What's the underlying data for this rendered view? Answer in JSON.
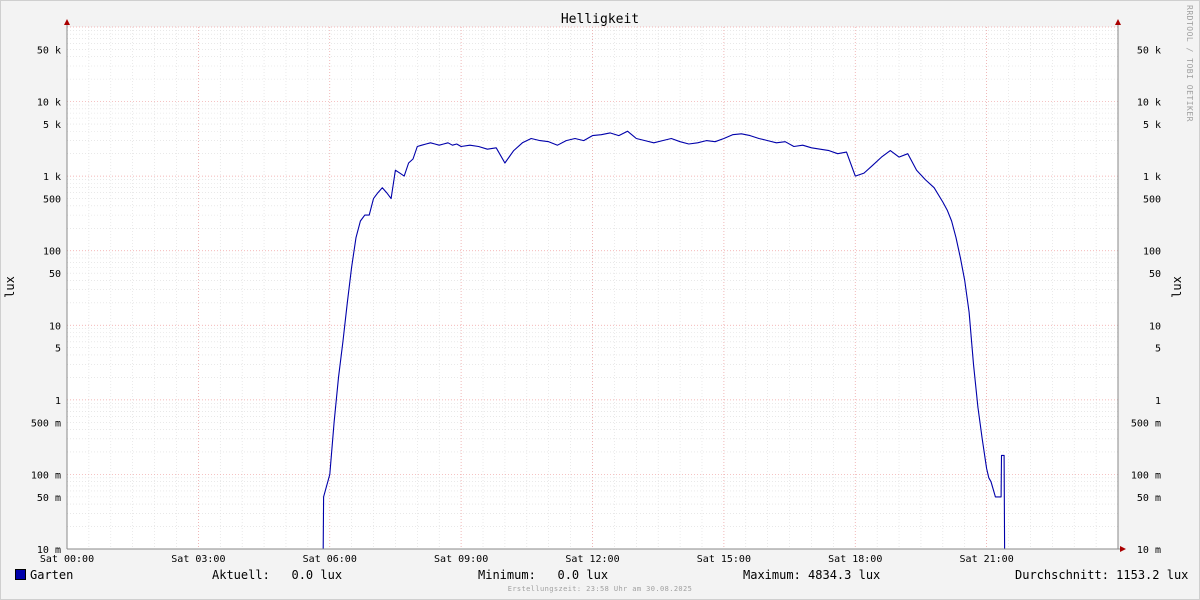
{
  "chart_data": {
    "type": "line",
    "title": "Helligkeit",
    "ylabel": "lux",
    "y_scale": "log",
    "ylim": [
      0.01,
      100000
    ],
    "y_ticks": [
      {
        "v": 50000,
        "label": "50 k"
      },
      {
        "v": 10000,
        "label": "10 k"
      },
      {
        "v": 5000,
        "label": "5 k"
      },
      {
        "v": 1000,
        "label": "1 k"
      },
      {
        "v": 500,
        "label": "500"
      },
      {
        "v": 100,
        "label": "100"
      },
      {
        "v": 50,
        "label": "50"
      },
      {
        "v": 10,
        "label": "10"
      },
      {
        "v": 5,
        "label": "5"
      },
      {
        "v": 1,
        "label": "1"
      },
      {
        "v": 0.5,
        "label": "500 m"
      },
      {
        "v": 0.1,
        "label": "100 m"
      },
      {
        "v": 0.05,
        "label": "50 m"
      },
      {
        "v": 0.01,
        "label": "10 m"
      }
    ],
    "x_unit": "hours",
    "xlim": [
      0,
      24
    ],
    "x_ticks": [
      {
        "v": 0,
        "label": "Sat 00:00"
      },
      {
        "v": 3,
        "label": "Sat 03:00"
      },
      {
        "v": 6,
        "label": "Sat 06:00"
      },
      {
        "v": 9,
        "label": "Sat 09:00"
      },
      {
        "v": 12,
        "label": "Sat 12:00"
      },
      {
        "v": 15,
        "label": "Sat 15:00"
      },
      {
        "v": 18,
        "label": "Sat 18:00"
      },
      {
        "v": 21,
        "label": "Sat 21:00"
      }
    ],
    "grid": true,
    "series": [
      {
        "name": "Garten",
        "color": "#0000aa",
        "x": [
          0,
          5.85,
          5.86,
          6.0,
          6.1,
          6.2,
          6.3,
          6.4,
          6.5,
          6.6,
          6.7,
          6.8,
          6.9,
          7.0,
          7.1,
          7.2,
          7.3,
          7.4,
          7.5,
          7.6,
          7.7,
          7.8,
          7.9,
          8.0,
          8.1,
          8.2,
          8.3,
          8.4,
          8.5,
          8.6,
          8.7,
          8.8,
          8.9,
          9.0,
          9.2,
          9.4,
          9.6,
          9.8,
          10.0,
          10.2,
          10.4,
          10.6,
          10.8,
          11.0,
          11.2,
          11.4,
          11.6,
          11.8,
          12.0,
          12.2,
          12.4,
          12.6,
          12.8,
          13.0,
          13.2,
          13.4,
          13.6,
          13.8,
          14.0,
          14.2,
          14.4,
          14.6,
          14.8,
          15.0,
          15.2,
          15.4,
          15.6,
          15.8,
          16.0,
          16.2,
          16.4,
          16.6,
          16.8,
          17.0,
          17.2,
          17.4,
          17.6,
          17.8,
          18.0,
          18.2,
          18.4,
          18.6,
          18.8,
          19.0,
          19.2,
          19.4,
          19.6,
          19.8,
          20.0,
          20.1,
          20.2,
          20.3,
          20.4,
          20.5,
          20.6,
          20.7,
          20.8,
          20.9,
          21.0,
          21.05,
          21.1,
          21.2,
          21.25,
          21.3,
          21.33,
          21.34,
          21.4,
          21.41,
          24
        ],
        "y": [
          0.01,
          0.01,
          0.05,
          0.1,
          0.5,
          2,
          6,
          20,
          60,
          150,
          250,
          300,
          300,
          500,
          600,
          700,
          600,
          500,
          1200,
          1100,
          1000,
          1500,
          1700,
          2500,
          2600,
          2700,
          2800,
          2700,
          2600,
          2700,
          2800,
          2600,
          2700,
          2500,
          2600,
          2500,
          2300,
          2400,
          1500,
          2200,
          2800,
          3200,
          3000,
          2900,
          2600,
          3000,
          3200,
          3000,
          3500,
          3600,
          3800,
          3500,
          4000,
          3200,
          3000,
          2800,
          3000,
          3200,
          2900,
          2700,
          2800,
          3000,
          2900,
          3200,
          3600,
          3700,
          3500,
          3200,
          3000,
          2800,
          2900,
          2500,
          2600,
          2400,
          2300,
          2200,
          2000,
          2100,
          1000,
          1100,
          1400,
          1800,
          2200,
          1800,
          2000,
          1200,
          900,
          700,
          450,
          350,
          250,
          150,
          80,
          40,
          15,
          3,
          0.8,
          0.3,
          0.12,
          0.09,
          0.08,
          0.05,
          0.05,
          0.05,
          0.05,
          0.18,
          0.18,
          0.01,
          0.01
        ]
      }
    ]
  },
  "legend": {
    "series_name": "Garten",
    "current": "Aktuell:   0.0 lux",
    "minimum": "Minimum:   0.0 lux",
    "maximum": "Maximum: 4834.3 lux",
    "average": "Durchschnitt: 1153.2 lux"
  },
  "watermark": "RRDTOOL / TOBI OETIKER",
  "footer": "Erstellungszeit: 23:58 Uhr am 30.08.2025"
}
